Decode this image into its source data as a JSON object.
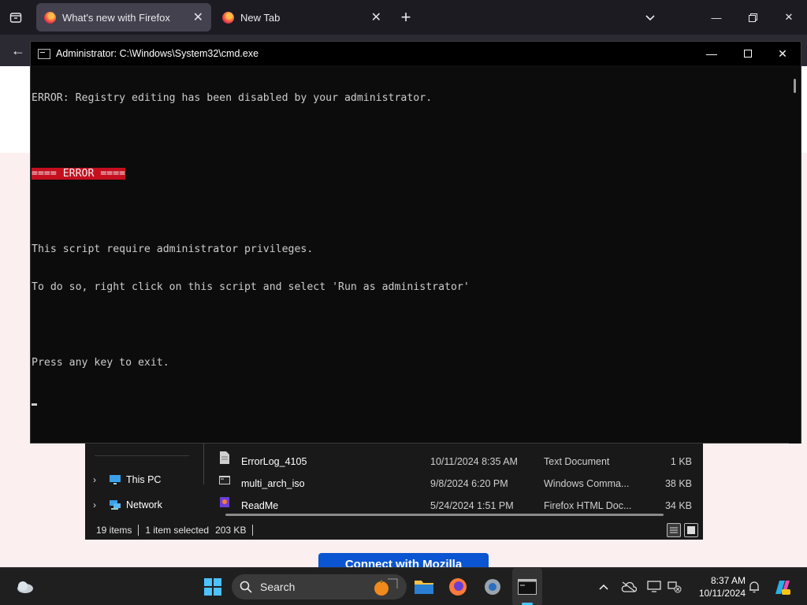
{
  "firefox": {
    "tabs": [
      {
        "title": "What's new with Firefox",
        "active": true
      },
      {
        "title": "New Tab",
        "active": false
      }
    ],
    "new_tab_symbol": "+",
    "list_all_tabs_symbol": "⌄",
    "back_symbol": "←",
    "connect_button_label": "Connect with Mozilla"
  },
  "window_controls": {
    "minimize": "—",
    "maximize": "☐",
    "close": "✕"
  },
  "cmd": {
    "title": "Administrator: C:\\Windows\\System32\\cmd.exe",
    "lines": [
      "ERROR: Registry editing has been disabled by your administrator.",
      "",
      "==== ERROR ====",
      "",
      "This script require administrator privileges.",
      "To do so, right click on this script and select 'Run as administrator'",
      "",
      "Press any key to exit."
    ]
  },
  "explorer": {
    "nav": [
      {
        "label": "This PC",
        "icon": "computer-icon"
      },
      {
        "label": "Network",
        "icon": "network-icon"
      }
    ],
    "files": [
      {
        "name": "ErrorLog_4105",
        "date": "10/11/2024 8:35 AM",
        "type": "Text Document",
        "size": "1 KB",
        "icon": "text-file-icon"
      },
      {
        "name": "multi_arch_iso",
        "date": "9/8/2024 6:20 PM",
        "type": "Windows Comma...",
        "size": "38 KB",
        "icon": "cmd-file-icon"
      },
      {
        "name": "ReadMe",
        "date": "5/24/2024 1:51 PM",
        "type": "Firefox HTML Doc...",
        "size": "34 KB",
        "icon": "html-file-icon"
      }
    ],
    "status": {
      "items": "19 items",
      "selected": "1 item selected",
      "size": "203 KB"
    }
  },
  "taskbar": {
    "search_label": "Search",
    "time": "8:37 AM",
    "date": "10/11/2024",
    "overflow_symbol": "^"
  },
  "colors": {
    "cmd_error_bg": "#c50f1f",
    "firefox_blue": "#0b55d2",
    "taskbar_bg": "#1f1f1f"
  }
}
